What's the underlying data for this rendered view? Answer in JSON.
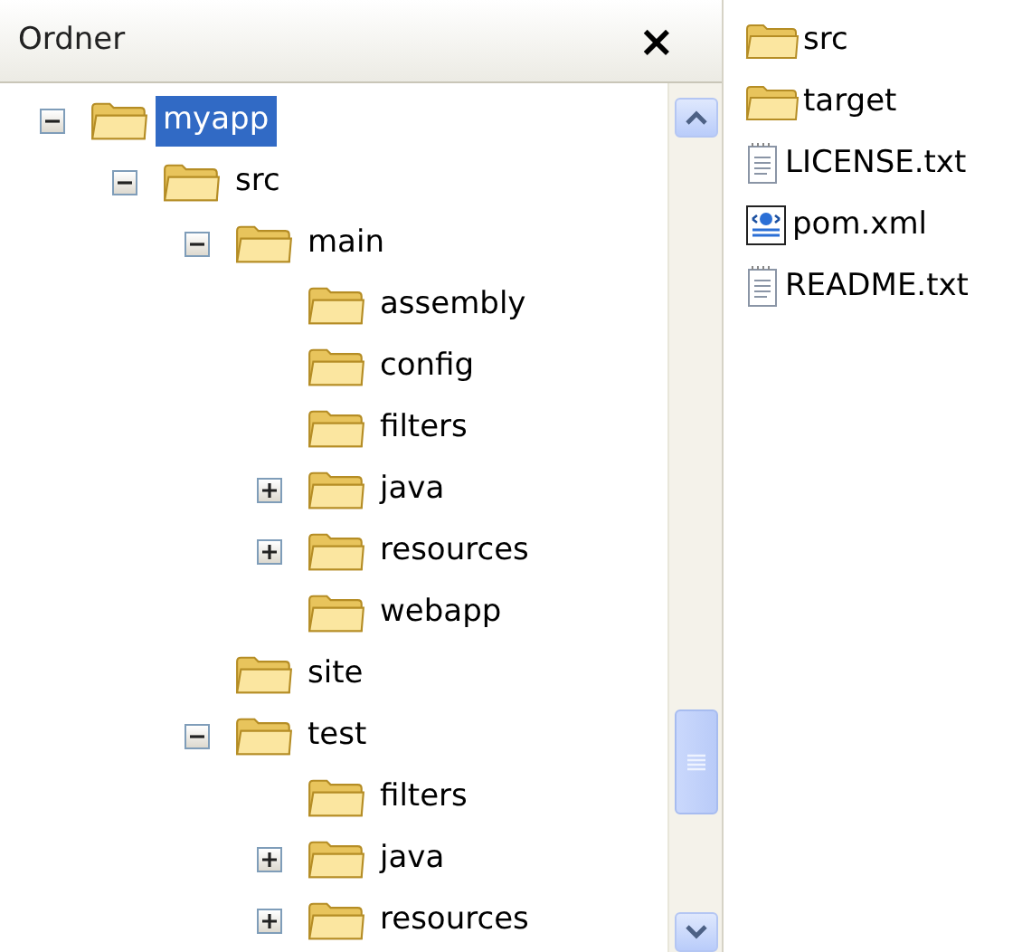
{
  "folder_pane": {
    "title": "Ordner",
    "close": "×"
  },
  "tree": [
    {
      "label": "myapp",
      "selected": true,
      "expanded": true,
      "children": [
        {
          "label": "src",
          "selected": false,
          "expanded": true,
          "children": [
            {
              "label": "main",
              "selected": false,
              "expanded": true,
              "children": [
                {
                  "label": "assembly",
                  "selected": false
                },
                {
                  "label": "config",
                  "selected": false
                },
                {
                  "label": "filters",
                  "selected": false
                },
                {
                  "label": "java",
                  "selected": false,
                  "expanded": false
                },
                {
                  "label": "resources",
                  "selected": false,
                  "expanded": false
                },
                {
                  "label": "webapp",
                  "selected": false
                }
              ]
            },
            {
              "label": "site",
              "selected": false
            },
            {
              "label": "test",
              "selected": false,
              "expanded": true,
              "children": [
                {
                  "label": "filters",
                  "selected": false
                },
                {
                  "label": "java",
                  "selected": false,
                  "expanded": false
                },
                {
                  "label": "resources",
                  "selected": false,
                  "expanded": false
                }
              ]
            }
          ]
        }
      ]
    }
  ],
  "files": [
    {
      "name": "src",
      "kind": "folder"
    },
    {
      "name": "target",
      "kind": "folder"
    },
    {
      "name": "LICENSE.txt",
      "kind": "text"
    },
    {
      "name": "pom.xml",
      "kind": "xml"
    },
    {
      "name": "README.txt",
      "kind": "text"
    }
  ]
}
